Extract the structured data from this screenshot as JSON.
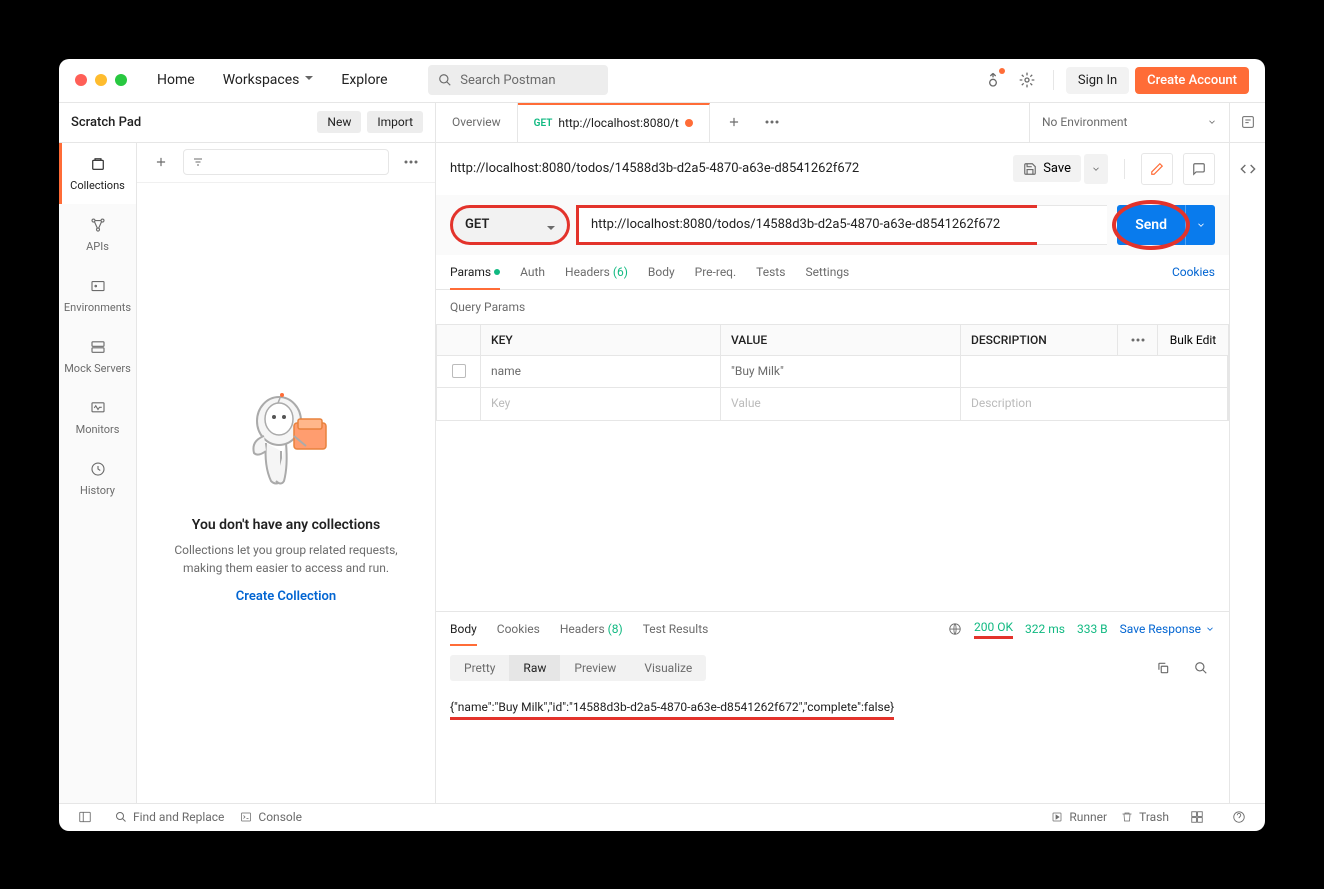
{
  "titlebar": {
    "menu": {
      "home": "Home",
      "workspaces": "Workspaces",
      "explore": "Explore"
    },
    "search_placeholder": "Search Postman",
    "sign_in": "Sign In",
    "create_account": "Create Account"
  },
  "scratch": {
    "title": "Scratch Pad",
    "new": "New",
    "import": "Import"
  },
  "sidebar": {
    "items": [
      {
        "label": "Collections"
      },
      {
        "label": "APIs"
      },
      {
        "label": "Environments"
      },
      {
        "label": "Mock Servers"
      },
      {
        "label": "Monitors"
      },
      {
        "label": "History"
      }
    ]
  },
  "empty": {
    "title": "You don't have any collections",
    "body": "Collections let you group related requests, making them easier to access and run.",
    "cta": "Create Collection"
  },
  "tabs": {
    "overview": "Overview",
    "active_method": "GET",
    "active_title": "http://localhost:8080/t",
    "env": "No Environment"
  },
  "request": {
    "title": "http://localhost:8080/todos/14588d3b-d2a5-4870-a63e-d8541262f672",
    "save": "Save",
    "method": "GET",
    "url": "http://localhost:8080/todos/14588d3b-d2a5-4870-a63e-d8541262f672",
    "send": "Send",
    "tabs": {
      "params": "Params",
      "auth": "Auth",
      "headers": "Headers",
      "headers_count": "(6)",
      "body": "Body",
      "prereq": "Pre-req.",
      "tests": "Tests",
      "settings": "Settings",
      "cookies": "Cookies"
    },
    "query_params_label": "Query Params",
    "table": {
      "headers": {
        "key": "KEY",
        "value": "VALUE",
        "desc": "DESCRIPTION",
        "bulk": "Bulk Edit"
      },
      "rows": [
        {
          "key": "name",
          "value": "\"Buy Milk\"",
          "desc": ""
        }
      ],
      "placeholder": {
        "key": "Key",
        "value": "Value",
        "desc": "Description"
      }
    }
  },
  "response": {
    "tabs": {
      "body": "Body",
      "cookies": "Cookies",
      "headers": "Headers",
      "headers_count": "(8)",
      "tests": "Test Results"
    },
    "status": "200 OK",
    "time": "322 ms",
    "size": "333 B",
    "save": "Save Response",
    "format": {
      "pretty": "Pretty",
      "raw": "Raw",
      "preview": "Preview",
      "visualize": "Visualize"
    },
    "body": "{\"name\":\"Buy Milk\",\"id\":\"14588d3b-d2a5-4870-a63e-d8541262f672\",\"complete\":false}"
  },
  "footer": {
    "find": "Find and Replace",
    "console": "Console",
    "runner": "Runner",
    "trash": "Trash"
  }
}
